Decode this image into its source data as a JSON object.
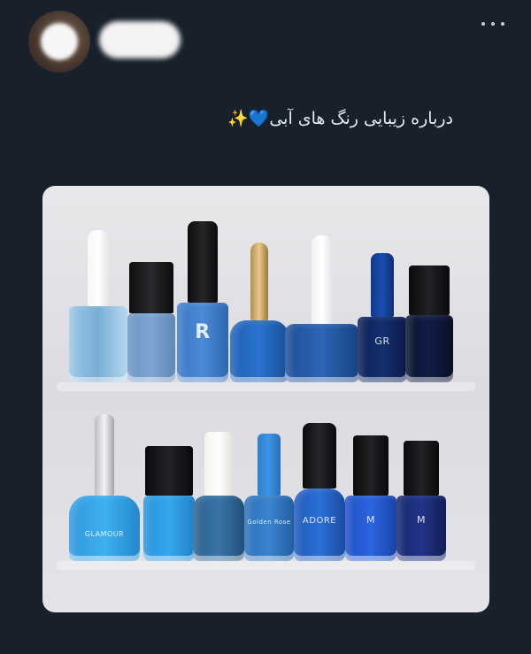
{
  "post": {
    "text": "درباره زیبایی رنگ های آبی💙✨",
    "image": {
      "label_row1_b3": "R",
      "label_row1_b6": "GR",
      "label_row2_b1": "GLAMOUR",
      "label_row2_b4": "Golden Rose",
      "label_row2_b5": "ADORE",
      "label_row2_b6": "M",
      "label_row2_b7": "M"
    }
  },
  "icons": {
    "more": "more-dots-icon"
  },
  "colors": {
    "background": "#17202b",
    "text": "#e8eaed"
  }
}
